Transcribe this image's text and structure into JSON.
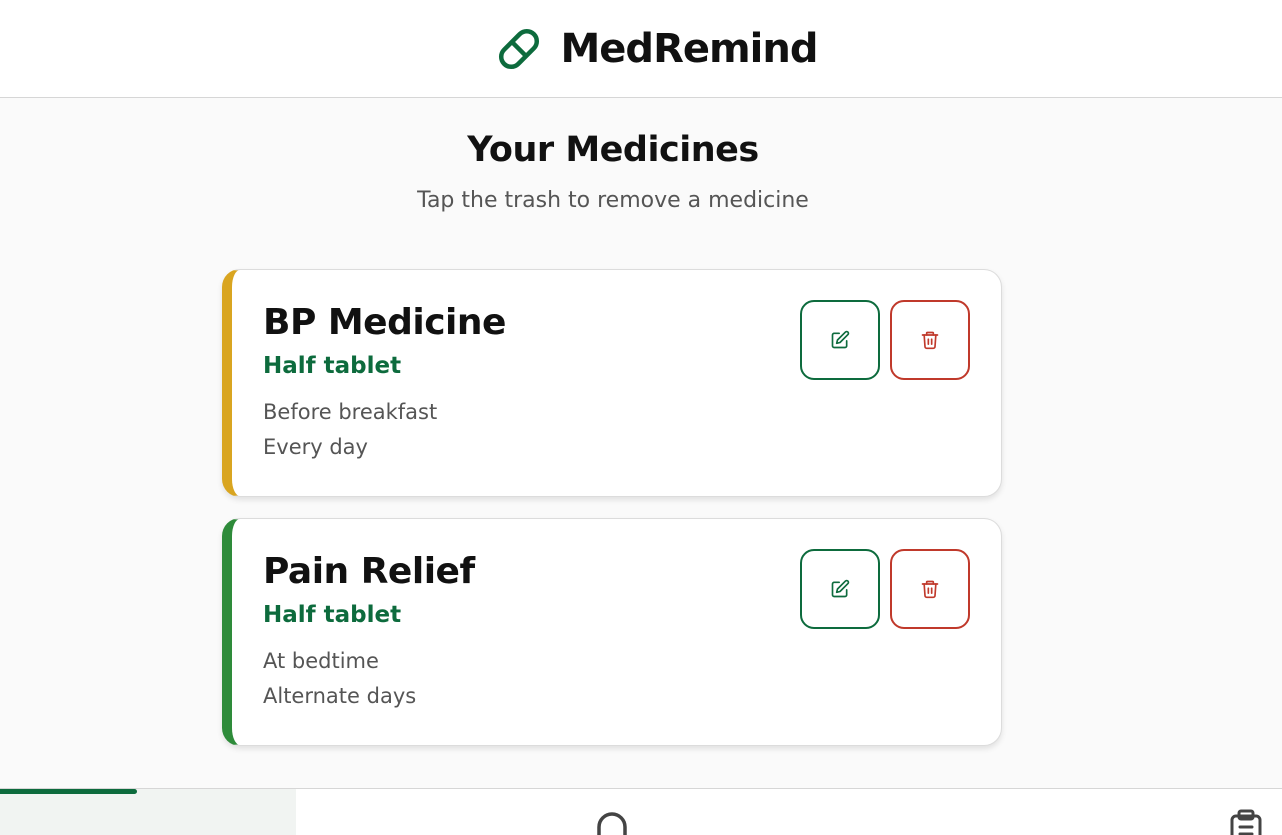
{
  "app": {
    "name": "MedRemind",
    "brand_color": "#0d6b3d",
    "logo_icon": "pill-icon"
  },
  "page": {
    "title": "Your Medicines",
    "subtitle": "Tap the trash to remove a medicine"
  },
  "medicines": [
    {
      "name": "BP Medicine",
      "dose": "Half tablet",
      "when": "Before breakfast",
      "frequency": "Every day",
      "accent_color": "#d9a520",
      "edit_icon": "edit-icon",
      "delete_icon": "trash-icon"
    },
    {
      "name": "Pain Relief",
      "dose": "Half tablet",
      "when": "At bedtime",
      "frequency": "Alternate days",
      "accent_color": "#2e8b3a",
      "edit_icon": "edit-icon",
      "delete_icon": "trash-icon"
    }
  ],
  "bottom_nav": {
    "items": [
      {
        "icon": "home-icon",
        "active": true
      },
      {
        "icon": "bell-icon",
        "active": false
      },
      {
        "icon": "clipboard-icon",
        "active": false
      }
    ]
  },
  "colors": {
    "edit": "#0d6b3d",
    "delete": "#c0392b",
    "dose_text": "#0d6b3d"
  }
}
